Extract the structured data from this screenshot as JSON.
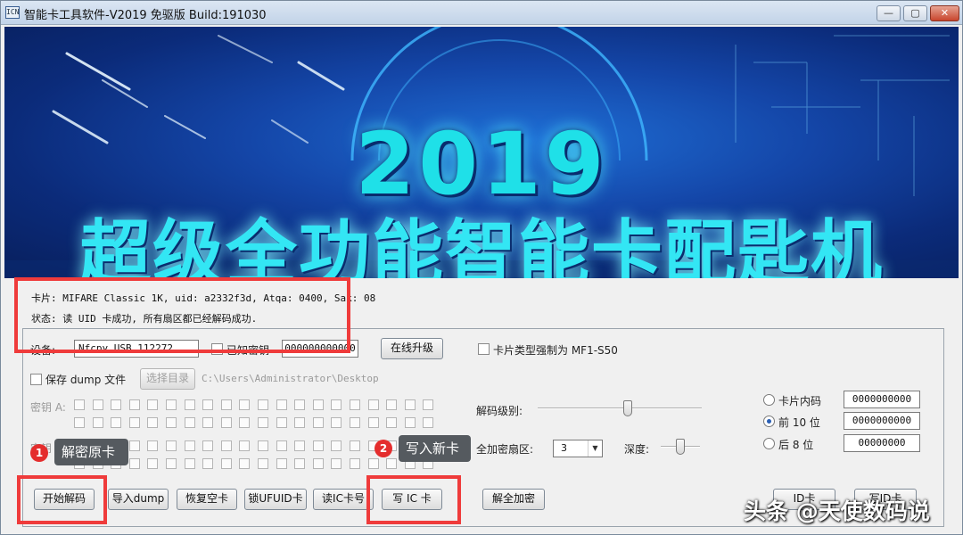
{
  "window": {
    "icon_text": "ICN",
    "title": "智能卡工具软件-V2019 免驱版 Build:191030",
    "min_symbol": "—",
    "max_symbol": "▢",
    "close_symbol": "✕"
  },
  "banner": {
    "year": "2019",
    "slogan": "超级全功能智能卡配匙机"
  },
  "info": {
    "card_line": "卡片: MIFARE Classic 1K, uid: a2332f3d,  Atqa: 0400,  Sak: 08",
    "status_line": "状态: 读 UID 卡成功, 所有扇区都已经解码成功."
  },
  "device": {
    "label": "设备:",
    "device_value": "Nfcpy USB 112272",
    "known_lock_label": "已知密钥",
    "key_input_value": "000000000000",
    "upgrade_button": "在线升级",
    "force_type_label": "卡片类型强制为 MF1-S50"
  },
  "save": {
    "save_dump_label": "保存 dump 文件",
    "choose_dir_button": "选择目录",
    "dir_path": "C:\\Users\\Administrator\\Desktop"
  },
  "keys": {
    "key_a_label": "密钥 A:",
    "key_b_label": "密钥 B:"
  },
  "decode": {
    "level_label": "解码级别:",
    "full_sector_label": "全加密扇区:",
    "sector_value": "3",
    "depth_label": "深度:",
    "level_value": 0.55,
    "depth_value": 0.5
  },
  "uid_options": {
    "card_inner_label": "卡片内码",
    "card_inner_value": "0000000000",
    "front_label": "前 10 位",
    "front_value": "0000000000",
    "back_label": "后  8 位",
    "back_value": "00000000",
    "selected": "front"
  },
  "actions": {
    "start_decode": "开始解码",
    "import_dump": "导入dump",
    "restore_blank": "恢复空卡",
    "lock_ufuid": "锁UFUID卡",
    "read_ic": "读IC卡号",
    "write_ic": "写 IC 卡",
    "decrypt_all": "解全加密",
    "id_card_left": "ID卡",
    "id_card_right": "写ID卡"
  },
  "annotations": {
    "callout1_num": "1",
    "callout1_text": "解密原卡",
    "callout2_num": "2",
    "callout2_text": "写入新卡",
    "highlight_color": "#ef3b3b"
  },
  "watermark": "头条 @天使数码说"
}
